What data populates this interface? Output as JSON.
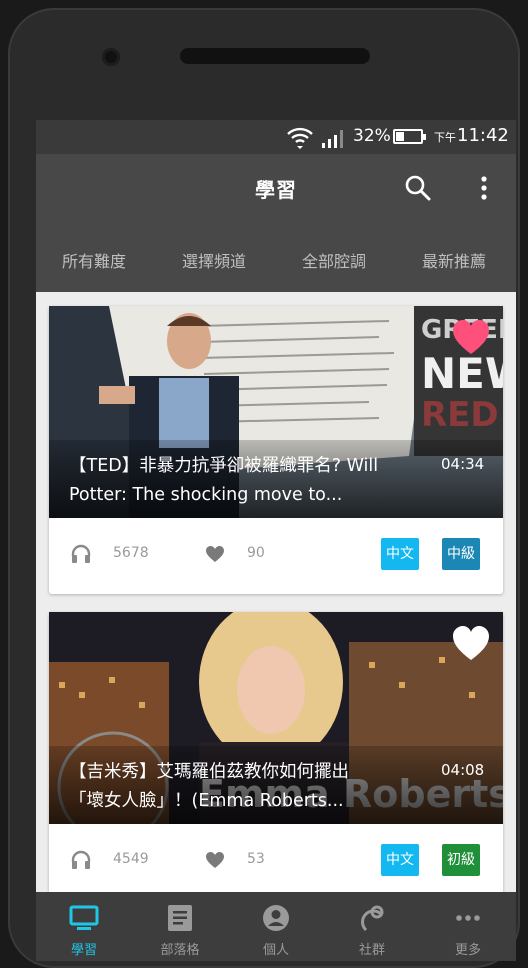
{
  "status_bar": {
    "battery_percent": "32%",
    "ampm": "下午",
    "time": "11:42"
  },
  "app_bar": {
    "title": "學習",
    "search_icon": "search-icon",
    "more_icon": "more-vert-icon"
  },
  "filters": [
    "所有難度",
    "選擇頻道",
    "全部腔調",
    "最新推薦"
  ],
  "cards": [
    {
      "title_line1": "【TED】非暴力抗爭卻被羅織罪名? Will",
      "title_line2": "Potter: The shocking move to...",
      "duration": "04:34",
      "favorited": true,
      "listens": "5678",
      "likes": "90",
      "language": "中文",
      "level": "中級",
      "level_color": "#1b87b5"
    },
    {
      "title_line1": "【吉米秀】艾瑪羅伯茲教你如何擺出",
      "title_line2": "「壞女人臉」！(Emma Roberts...",
      "duration": "04:08",
      "favorited": false,
      "listens": "4549",
      "likes": "53",
      "language": "中文",
      "level": "初級",
      "level_color": "#1f8f3a"
    }
  ],
  "bottom_nav": [
    {
      "label": "學習",
      "icon": "monitor-icon",
      "active": true
    },
    {
      "label": "部落格",
      "icon": "article-icon",
      "active": false
    },
    {
      "label": "個人",
      "icon": "account-icon",
      "active": false
    },
    {
      "label": "社群",
      "icon": "community-icon",
      "active": false
    },
    {
      "label": "更多",
      "icon": "more-horiz-icon",
      "active": false
    }
  ],
  "colors": {
    "accent": "#1ec6e8",
    "favorite": "#ff4f7b",
    "lang_badge": "#12b8ef"
  }
}
